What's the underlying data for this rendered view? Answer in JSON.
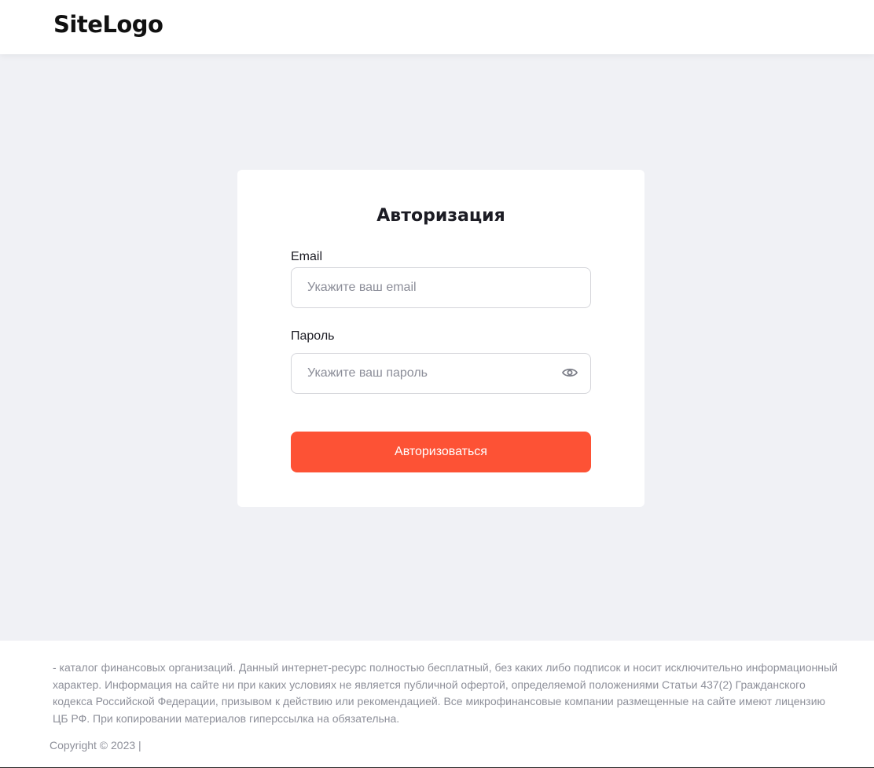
{
  "header": {
    "logo": "SiteLogo"
  },
  "login_form": {
    "title": "Авторизация",
    "email": {
      "label": "Email",
      "placeholder": "Укажите ваш email",
      "value": ""
    },
    "password": {
      "label": "Пароль",
      "placeholder": "Укажите ваш пароль",
      "value": "",
      "toggle_icon": "eye-icon"
    },
    "submit_label": "Авторизоваться"
  },
  "footer": {
    "disclaimer": "- каталог финансовых организаций. Данный интернет-ресурс полностью бесплатный, без каких либо подписок и носит исключительно информационный характер. Информация на сайте ни при каких условиях не является публичной офертой, определяемой положениями Статьи 437(2) Гражданского кодекса Российской Федерации, призывом к действию или рекомендацией. Все микрофинансовые компании размещенные на сайте имеют лицензию ЦБ РФ. При копировании материалов гиперссылка на обязательна.",
    "copyright": "Copyright © 2023 |"
  },
  "colors": {
    "accent": "#fd5235",
    "page_background": "#f0f1f5",
    "muted_text": "#8e909a"
  }
}
